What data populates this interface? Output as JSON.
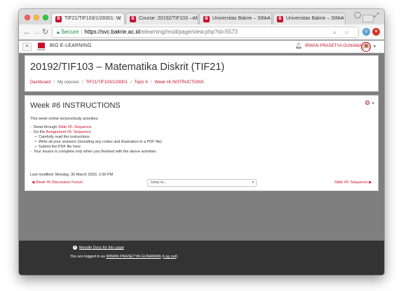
{
  "browser": {
    "tabs": [
      {
        "title": "TIF21/TIF103/1/28301: W",
        "active": true
      },
      {
        "title": "Course: 20192/TIF103 – M",
        "active": false
      },
      {
        "title": "Universitas Bakrie – SIM A",
        "active": false
      },
      {
        "title": "Universitas Bakrie – SIM A",
        "active": false
      }
    ],
    "secure_label": "Secure",
    "url_host": "https://svc.bakrie.ac.id",
    "url_path": "/elearning/mod/page/view.php?id=5573"
  },
  "navbar": {
    "logo_word": "BAKRIE",
    "brand": "BIG E-LEARNING",
    "user_name": "IRWAN PRASETYA GUNAWAN"
  },
  "header": {
    "course_title": "20192/TIF103 – Matematika Diskrit (TIF21)",
    "breadcrumb": [
      "Dashboard",
      "My courses",
      "TIF21/TIF103/1/28301",
      "Topic 6",
      "Week #6 INSTRUCTIONS"
    ]
  },
  "content": {
    "title": "Week #6 INSTRUCTIONS",
    "intro": "This week online lecture/study activities:",
    "items": [
      {
        "bullet": "-",
        "prefix": "Read through ",
        "link": "Slide #5: Sequence",
        "suffix": ""
      },
      {
        "bullet": "-",
        "prefix": "Do the ",
        "link": "Assignment #6: Sequence",
        "suffix": ""
      },
      {
        "bullet": "•",
        "prefix": "Carefully read the instructions",
        "link": "",
        "suffix": ""
      },
      {
        "bullet": "•",
        "prefix": "Write all your answers (including any codes and illustration in a PDF file)",
        "link": "",
        "suffix": ""
      },
      {
        "bullet": "•",
        "prefix": "Submit the PDF file here",
        "link": "",
        "suffix": ""
      },
      {
        "bullet": "-",
        "prefix": "Your lesson is complete only when you finished with the above activities",
        "link": "",
        "suffix": ""
      }
    ],
    "last_modified": "Last modified: Monday, 30 March 2020, 1:00 PM",
    "prev_link": "Week #5 Discussion Forum",
    "jump_to": "Jump to...",
    "next_link": "Slide #5: Sequence"
  },
  "footer": {
    "docs_link": "Moodle Docs for this page",
    "logged_in_prefix": "You are logged in as ",
    "logged_in_user": "IRWAN PRASETYA GUNAWAN",
    "logout_open": " (",
    "logout_label": "Log out",
    "logout_close": ")"
  },
  "colors": {
    "accent": "#c8102e",
    "footer_bg": "#333333",
    "page_bg": "#7f7f7f"
  }
}
